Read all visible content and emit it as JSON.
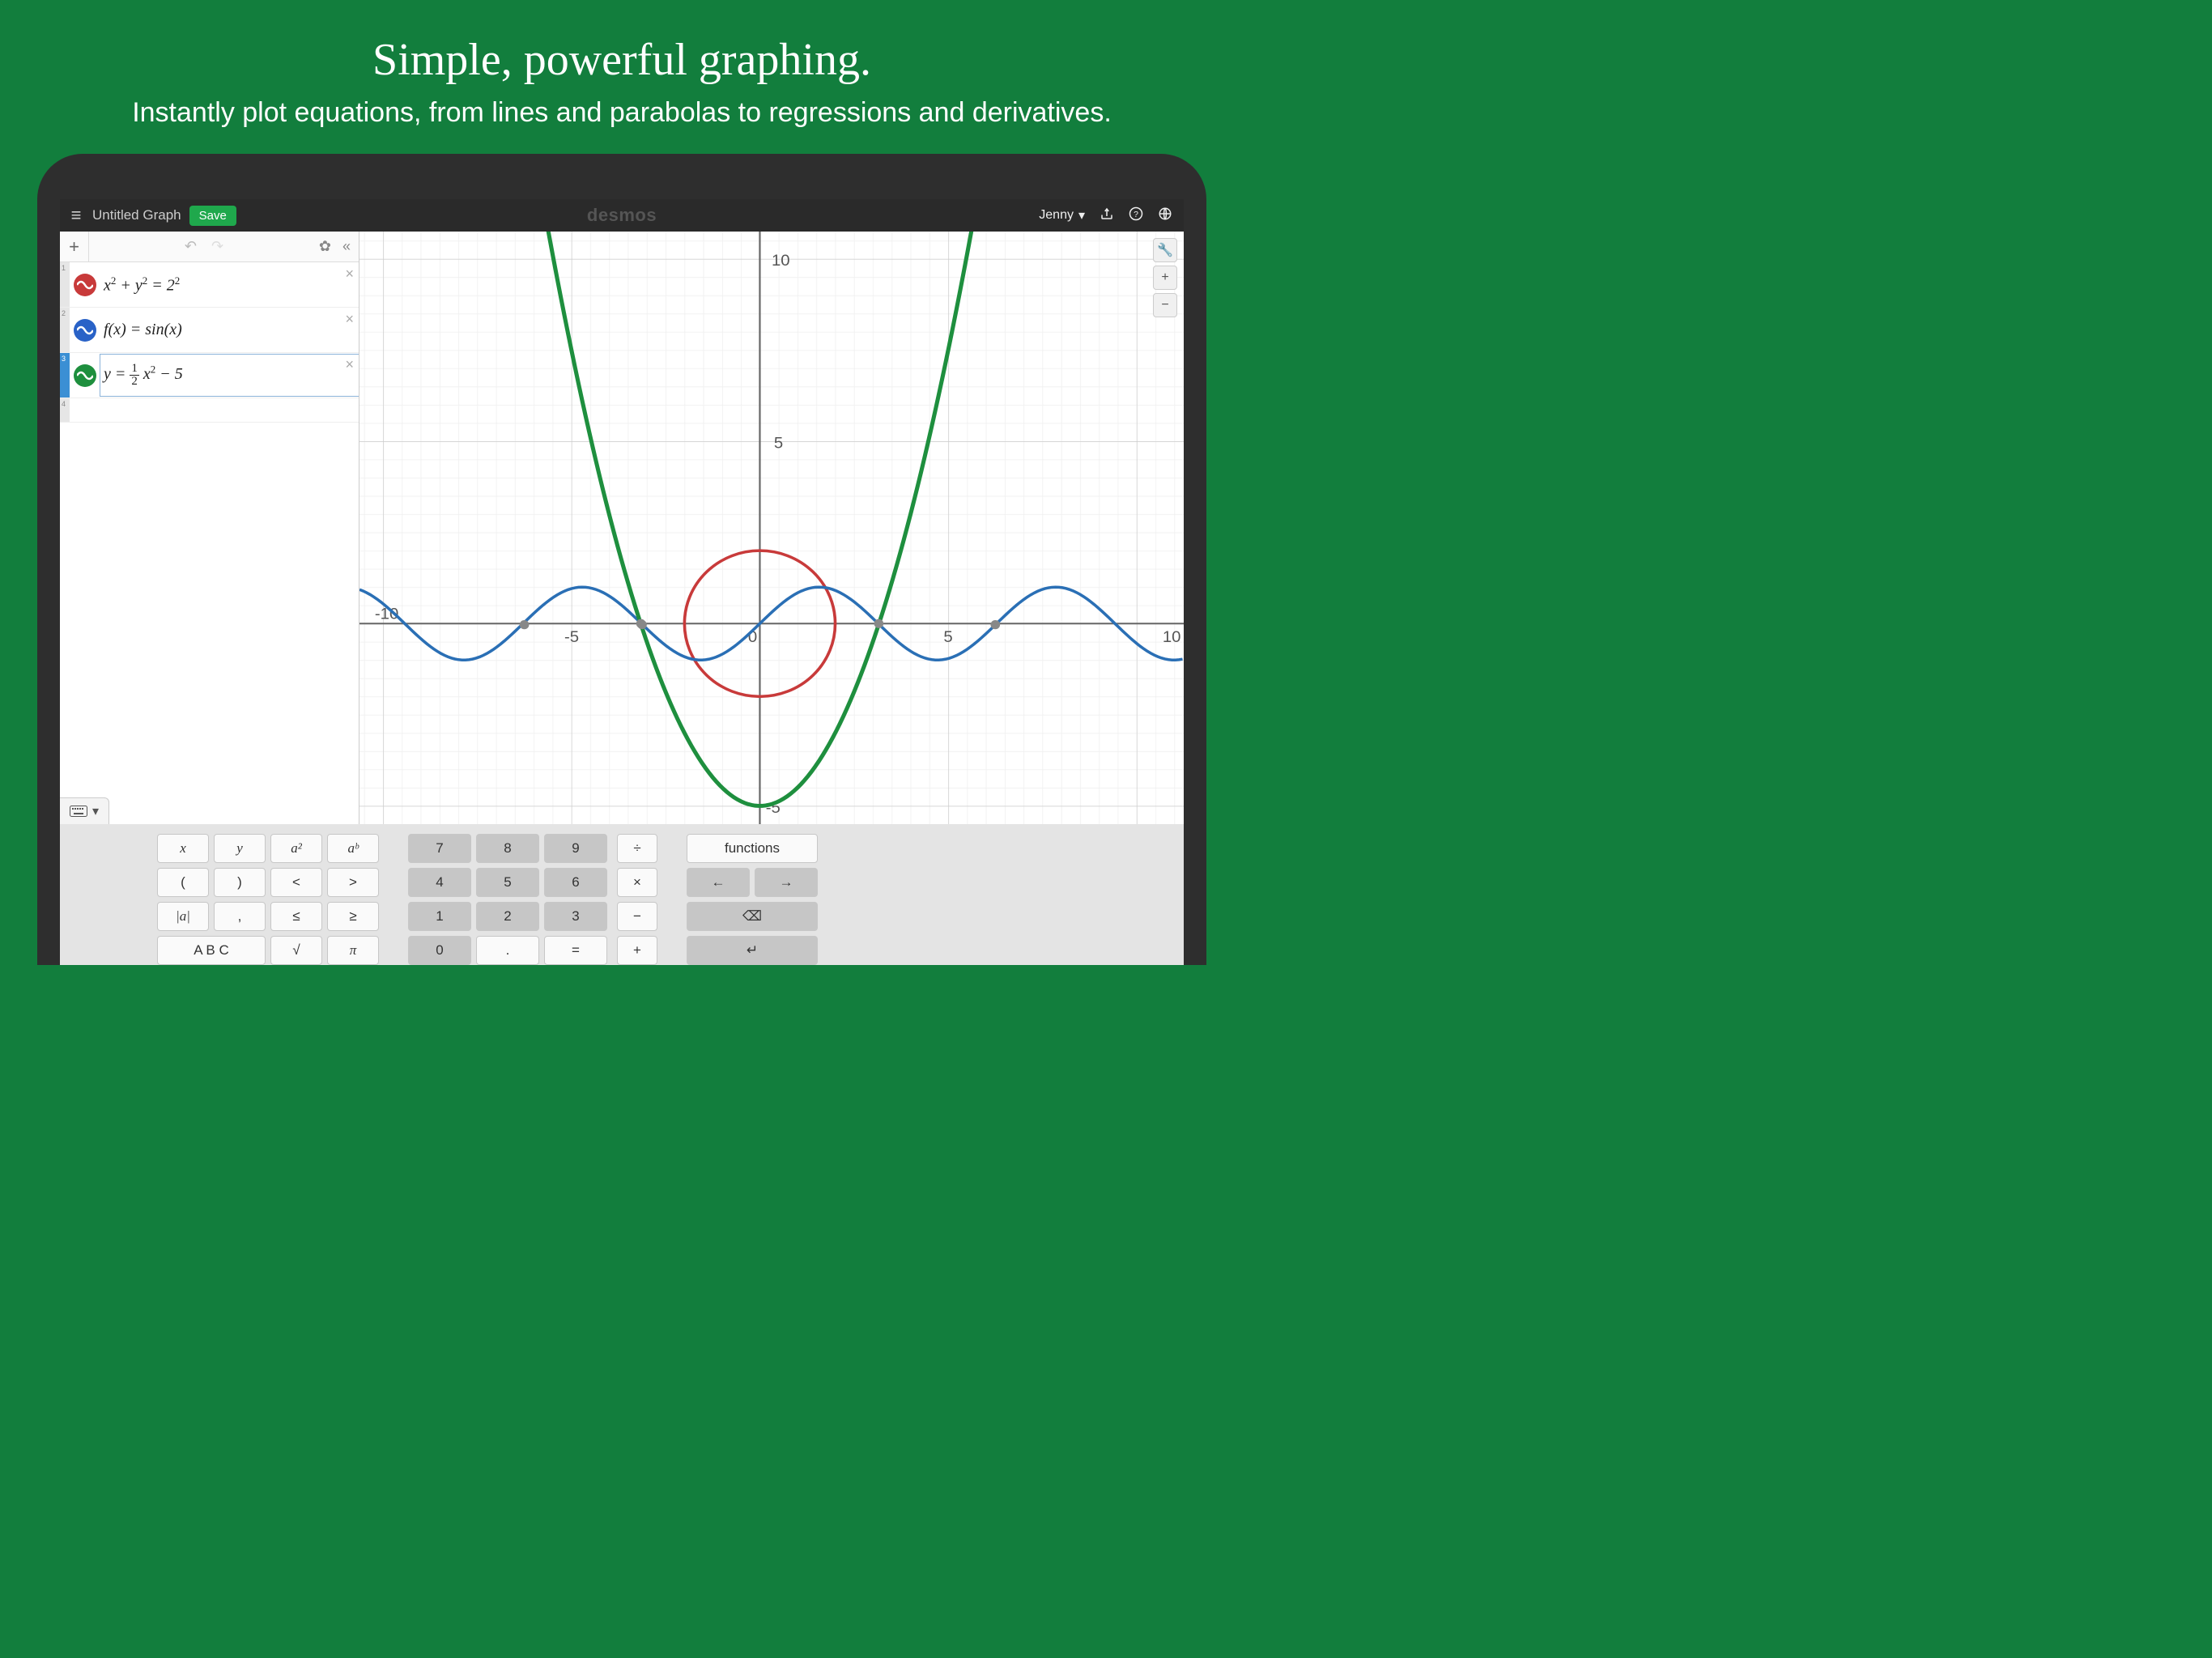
{
  "hero": {
    "title": "Simple, powerful graphing.",
    "subtitle": "Instantly plot equations, from lines and parabolas to regressions and derivatives."
  },
  "topbar": {
    "graph_title": "Untitled Graph",
    "save_label": "Save",
    "brand": "desmos",
    "user": "Jenny"
  },
  "sidebar": {
    "items": [
      {
        "num": "1",
        "color": "red"
      },
      {
        "num": "2",
        "color": "blue"
      },
      {
        "num": "3",
        "color": "green"
      },
      {
        "num": "4",
        "color": ""
      }
    ]
  },
  "keyboard": {
    "g1": [
      "x",
      "y",
      "a²",
      "aᵇ",
      "(",
      ")",
      "<",
      ">",
      "|a|",
      ",",
      "≤",
      "≥"
    ],
    "g1_bottom": [
      "A B C",
      "√",
      "π"
    ],
    "g2_nums": [
      "7",
      "8",
      "9",
      "4",
      "5",
      "6",
      "1",
      "2",
      "3"
    ],
    "g2_bottom": [
      "0",
      ".",
      "="
    ],
    "g2_ops": [
      "÷",
      "×",
      "−",
      "+"
    ],
    "g3": {
      "functions": "functions",
      "left": "←",
      "right": "→",
      "back": "⌫",
      "enter": "↵"
    }
  },
  "chart_data": {
    "type": "line",
    "xlim": [
      -10,
      10
    ],
    "ylim": [
      -5,
      10
    ],
    "grid": true,
    "x_ticks": [
      -10,
      -5,
      0,
      5,
      10
    ],
    "y_ticks": [
      -5,
      5,
      10
    ],
    "series": [
      {
        "name": "circle",
        "color": "#c83a3a",
        "equation": "x^2 + y^2 = 2^2",
        "shape": "circle",
        "cx": 0,
        "cy": 0,
        "r": 2
      },
      {
        "name": "sine",
        "color": "#2a6fb5",
        "equation": "f(x) = sin(x)",
        "x": [
          -10,
          -9,
          -8,
          -7,
          -6,
          -5,
          -4,
          -3,
          -2,
          -1,
          0,
          1,
          2,
          3,
          4,
          5,
          6,
          7,
          8,
          9,
          10
        ],
        "y": [
          0.544,
          -0.412,
          -0.989,
          -0.657,
          0.279,
          0.959,
          0.757,
          -0.141,
          -0.909,
          -0.841,
          0,
          0.841,
          0.909,
          0.141,
          -0.757,
          -0.959,
          -0.279,
          0.657,
          0.989,
          0.412,
          -0.544
        ]
      },
      {
        "name": "parabola",
        "color": "#1e8f3e",
        "equation": "y = 0.5 x^2 - 5",
        "x": [
          -6,
          -5,
          -4,
          -3,
          -2,
          -1,
          0,
          1,
          2,
          3,
          4,
          5,
          6
        ],
        "y": [
          13,
          7.5,
          3,
          -0.5,
          -3,
          -4.5,
          -5,
          -4.5,
          -3,
          -0.5,
          3,
          7.5,
          13
        ]
      }
    ]
  }
}
